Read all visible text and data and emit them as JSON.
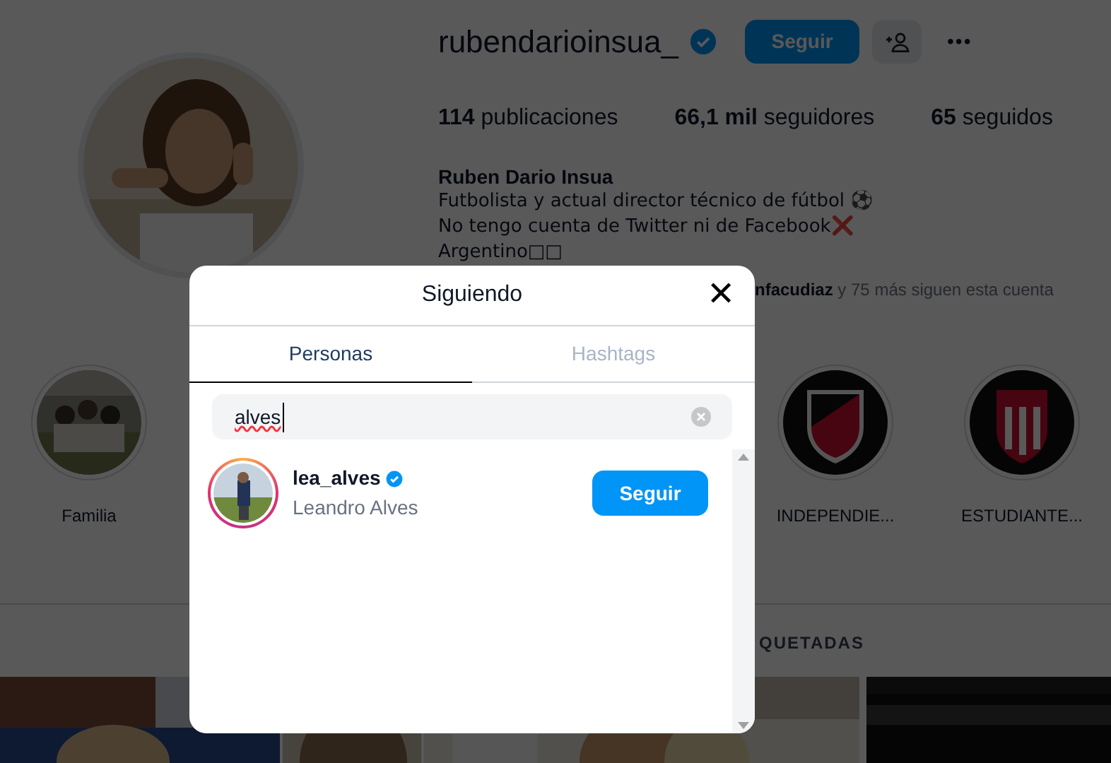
{
  "profile": {
    "username": "rubendarioinsua_",
    "follow_button": "Seguir",
    "more_button": "•••",
    "stats": [
      {
        "value": "114",
        "label": "publicaciones"
      },
      {
        "value": "66,1 mil",
        "label": "seguidores"
      },
      {
        "value": "65",
        "label": "seguidos"
      }
    ],
    "name": "Ruben Dario Insua",
    "bio": [
      "Futbolista y actual director técnico de fútbol ⚽",
      "No tengo cuenta de Twitter ni de Facebook❌",
      "Argentino□□"
    ],
    "followed_by": "**nfacudiaz** y 75 más siguen esta cuenta"
  },
  "highlights": [
    {
      "label": "Familia"
    },
    {
      "label": "INDEPENDIE..."
    },
    {
      "label": "ESTUDIANTE..."
    }
  ],
  "profile_tab": "QUETADAS",
  "dialog": {
    "title": "Siguiendo",
    "close": "✕",
    "tabs": [
      {
        "label": "Personas",
        "selected": true
      },
      {
        "label": "Hashtags",
        "selected": false
      }
    ],
    "search": {
      "value": "alves"
    },
    "results": [
      {
        "username": "lea_alves",
        "name": "Leandro Alves",
        "button": "Seguir"
      }
    ]
  }
}
